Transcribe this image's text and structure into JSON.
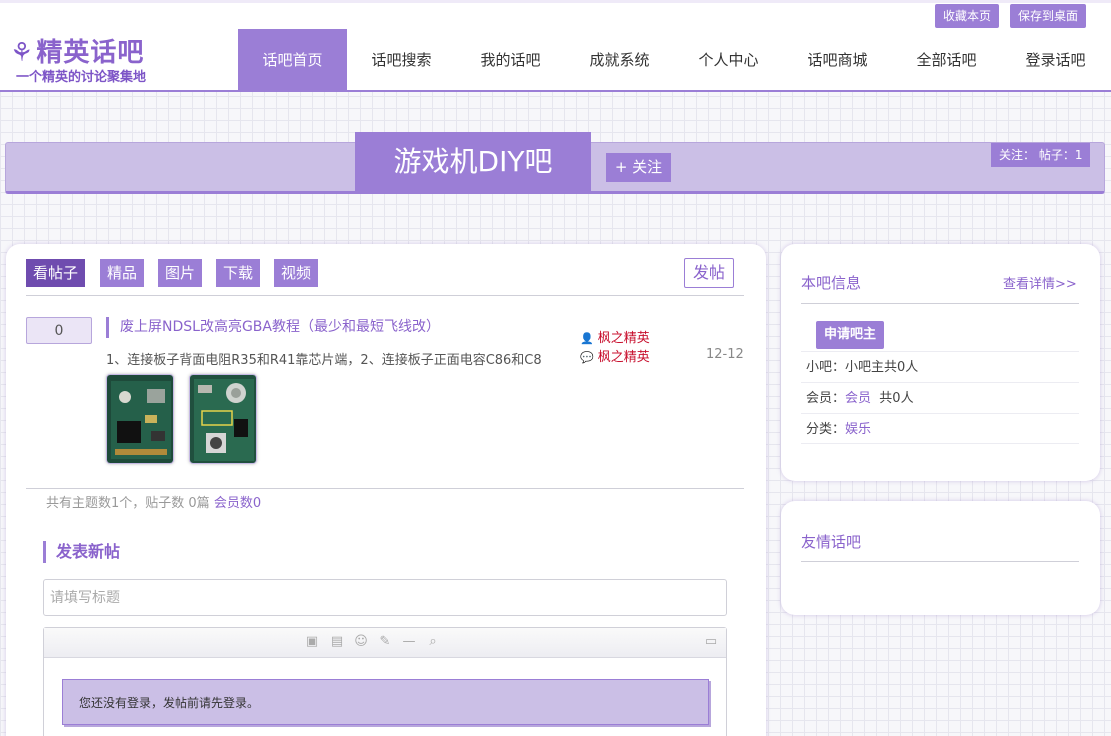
{
  "header": {
    "logo_mark": "⚘",
    "logo_title": "精英话吧",
    "logo_subtitle": "一个精英的讨论聚集地",
    "top_buttons": [
      "收藏本页",
      "保存到桌面"
    ],
    "nav": [
      "话吧首页",
      "话吧搜索",
      "我的话吧",
      "成就系统",
      "个人中心",
      "话吧商城",
      "全部话吧",
      "登录话吧"
    ],
    "nav_active_index": 0
  },
  "banner": {
    "title": "游戏机DIY吧",
    "follow_label": "+ 关注",
    "stats": "关注： 帖子：1"
  },
  "main": {
    "tabs": [
      "看帖子",
      "精品",
      "图片",
      "下载",
      "视频"
    ],
    "active_tab_index": 0,
    "post_button": "发帖",
    "thread": {
      "reply_count": "0",
      "title": "废上屏NDSL改高亮GBA教程（最少和最短飞线改）",
      "excerpt": "1、连接板子背面电阻R35和R41靠芯片端，2、连接板子正面电容C86和C8",
      "author": "枫之精英",
      "last_reply_user": "枫之精英",
      "date": "12-12",
      "thumbnails": 2
    },
    "totals": {
      "prefix": "共有主题数1个，贴子数 0篇 ",
      "members": "会员数0"
    },
    "new_post": {
      "heading": "发表新帖",
      "title_placeholder": "请填写标题",
      "login_notice": "您还没有登录，发帖前请先登录。"
    }
  },
  "sidebar": {
    "info_title": "本吧信息",
    "detail_link": "查看详情>>",
    "apply_button": "申请吧主",
    "rows": {
      "admin": "小吧：小吧主共0人",
      "members_label": "会员：",
      "members_link": "会员",
      "members_count": "  共0人",
      "category_label": "分类：",
      "category_link": "娱乐"
    },
    "friends_title": "友情话吧"
  },
  "colors": {
    "accent": "#9b7ed6",
    "accent_dark": "#6f4caf",
    "banner_fill": "#cbbfe6",
    "author_red": "#c8102e"
  }
}
